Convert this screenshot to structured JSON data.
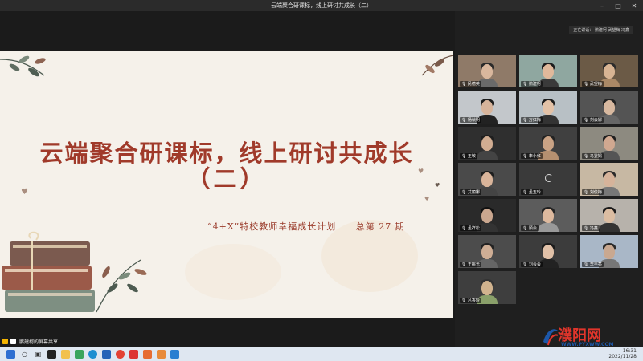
{
  "window": {
    "title": "云端聚合研课标，线上研讨共成长（二）"
  },
  "meeting": {
    "speaking_label": "正在讲话：",
    "speaking_names": "鹏建柯 武望梅 冯鑫",
    "presenter_label": "鹏建柯的屏幕共享"
  },
  "slide": {
    "title": "云端聚合研课标，线上研讨共成长",
    "subtitle": "（二）",
    "program": "“4+X”特校教师幸福成长计划",
    "issue": "总第 27 期"
  },
  "participants": [
    {
      "name": "民德英",
      "type": "video",
      "bg": "#8f7a68",
      "skin": "#d9b79d",
      "hair": "#2a2a2a",
      "body": "#6a6a6a"
    },
    {
      "name": "鹏建柯",
      "type": "video",
      "bg": "#8fa7a0",
      "skin": "#e0b99b",
      "hair": "#1c1c1c",
      "body": "#3a3a3a"
    },
    {
      "name": "武望梅",
      "type": "video",
      "bg": "#6b5a46",
      "skin": "#d8b493",
      "hair": "#2b2b2b",
      "body": "#aa8866"
    },
    {
      "name": "杨秋明",
      "type": "video",
      "bg": "#c3c7cb",
      "skin": "#d7b49b",
      "hair": "#1d1d1d",
      "body": "#222"
    },
    {
      "name": "万红梅",
      "type": "video",
      "bg": "#b8c0c5",
      "skin": "#e3c2a7",
      "hair": "#1d1d1d",
      "body": "#333"
    },
    {
      "name": "刘云娜",
      "type": "video",
      "bg": "#545454",
      "skin": "#d7b89f",
      "hair": "#222",
      "body": "#666"
    },
    {
      "name": "王敏",
      "type": "video",
      "bg": "#2f2f2f",
      "skin": "#d1ad92",
      "hair": "#1e1e1e",
      "body": "#444"
    },
    {
      "name": "李小红",
      "type": "video",
      "bg": "#404040",
      "skin": "#caa385",
      "hair": "#222",
      "body": "#b59070"
    },
    {
      "name": "马委娟",
      "type": "video",
      "bg": "#8d8a80",
      "skin": "#d0a890",
      "hair": "#1f1f1f",
      "body": "#555"
    },
    {
      "name": "艾丽娜",
      "type": "video",
      "bg": "#4a4a4a",
      "skin": "#d9b49a",
      "hair": "#1d1d1d",
      "body": "#444"
    },
    {
      "name": "孟玉玲",
      "type": "loading",
      "bg": "#3a3a3a"
    },
    {
      "name": "刘俊梅",
      "type": "video",
      "bg": "#c7b8a3",
      "skin": "#d6b39a",
      "hair": "#2a2a2a",
      "body": "#777"
    },
    {
      "name": "孟祥松",
      "type": "video",
      "bg": "#2a2a2a",
      "skin": "#caa78f",
      "hair": "#111",
      "body": "#333"
    },
    {
      "name": "顾会",
      "type": "video",
      "bg": "#5c5c5c",
      "skin": "#ddb99e",
      "hair": "#222",
      "body": "#999"
    },
    {
      "name": "冯鑫",
      "type": "video",
      "bg": "#b7b2ab",
      "skin": "#dbbda2",
      "hair": "#1a1a1a",
      "body": "#333"
    },
    {
      "name": "王桃光",
      "type": "video",
      "bg": "#4c4c4c",
      "skin": "#cfae95",
      "hair": "#222",
      "body": "#666"
    },
    {
      "name": "刘会会",
      "type": "video",
      "bg": "#3c3c3c",
      "skin": "#e1c1a8",
      "hair": "#1b1b1b",
      "body": "#222"
    },
    {
      "name": "李丰亮",
      "type": "video",
      "bg": "#a9b7c7",
      "skin": "#c9a890",
      "hair": "#2a2a2a",
      "body": "#777"
    },
    {
      "name": "吕香玲",
      "type": "video",
      "bg": "#3e3e3e",
      "skin": "#d1b38e",
      "hair": "#333",
      "body": "#8aa06a"
    }
  ],
  "taskbar": {
    "time": "16:31",
    "date": "2022/11/28",
    "lang": "中"
  },
  "watermark": {
    "text": "濮阳网",
    "url": "WWW.PYXWW.COM"
  }
}
